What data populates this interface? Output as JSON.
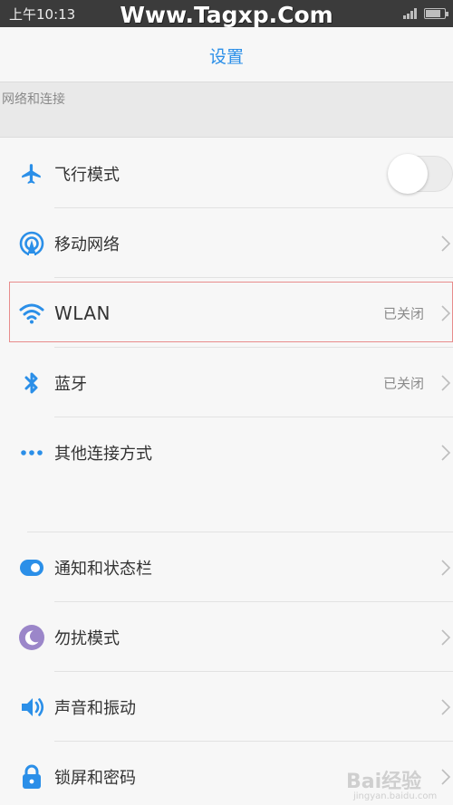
{
  "status_bar": {
    "time": "上午10:13",
    "watermark": "Www.Tagxp.Com",
    "battery_level": 0.8,
    "signal_bars": 4
  },
  "header": {
    "title": "设置"
  },
  "section_network": {
    "label": "网络和连接"
  },
  "rows": [
    {
      "label": "飞行模式",
      "icon": "airplane-icon",
      "control": "toggle",
      "toggle_on": false
    },
    {
      "label": "移动网络",
      "icon": "cellular-icon",
      "control": "chevron"
    },
    {
      "label": "WLAN",
      "icon": "wifi-icon",
      "control": "chevron",
      "value": "已关闭",
      "highlighted": true
    },
    {
      "label": "蓝牙",
      "icon": "bluetooth-icon",
      "control": "chevron",
      "value": "已关闭"
    },
    {
      "label": "其他连接方式",
      "icon": "more-dots-icon",
      "control": "chevron"
    },
    {
      "label": "通知和状态栏",
      "icon": "notification-icon",
      "control": "chevron"
    },
    {
      "label": "勿扰模式",
      "icon": "moon-icon",
      "control": "chevron"
    },
    {
      "label": "声音和振动",
      "icon": "speaker-icon",
      "control": "chevron"
    },
    {
      "label": "锁屏和密码",
      "icon": "lock-icon",
      "control": "chevron"
    }
  ],
  "watermark_bottom": {
    "text": "Bai经验",
    "url_text": "jingyan.baidu.com"
  },
  "colors": {
    "accent": "#2b8fe8",
    "highlight_border": "#e88c8c",
    "moon_badge": "#9b86c9"
  }
}
